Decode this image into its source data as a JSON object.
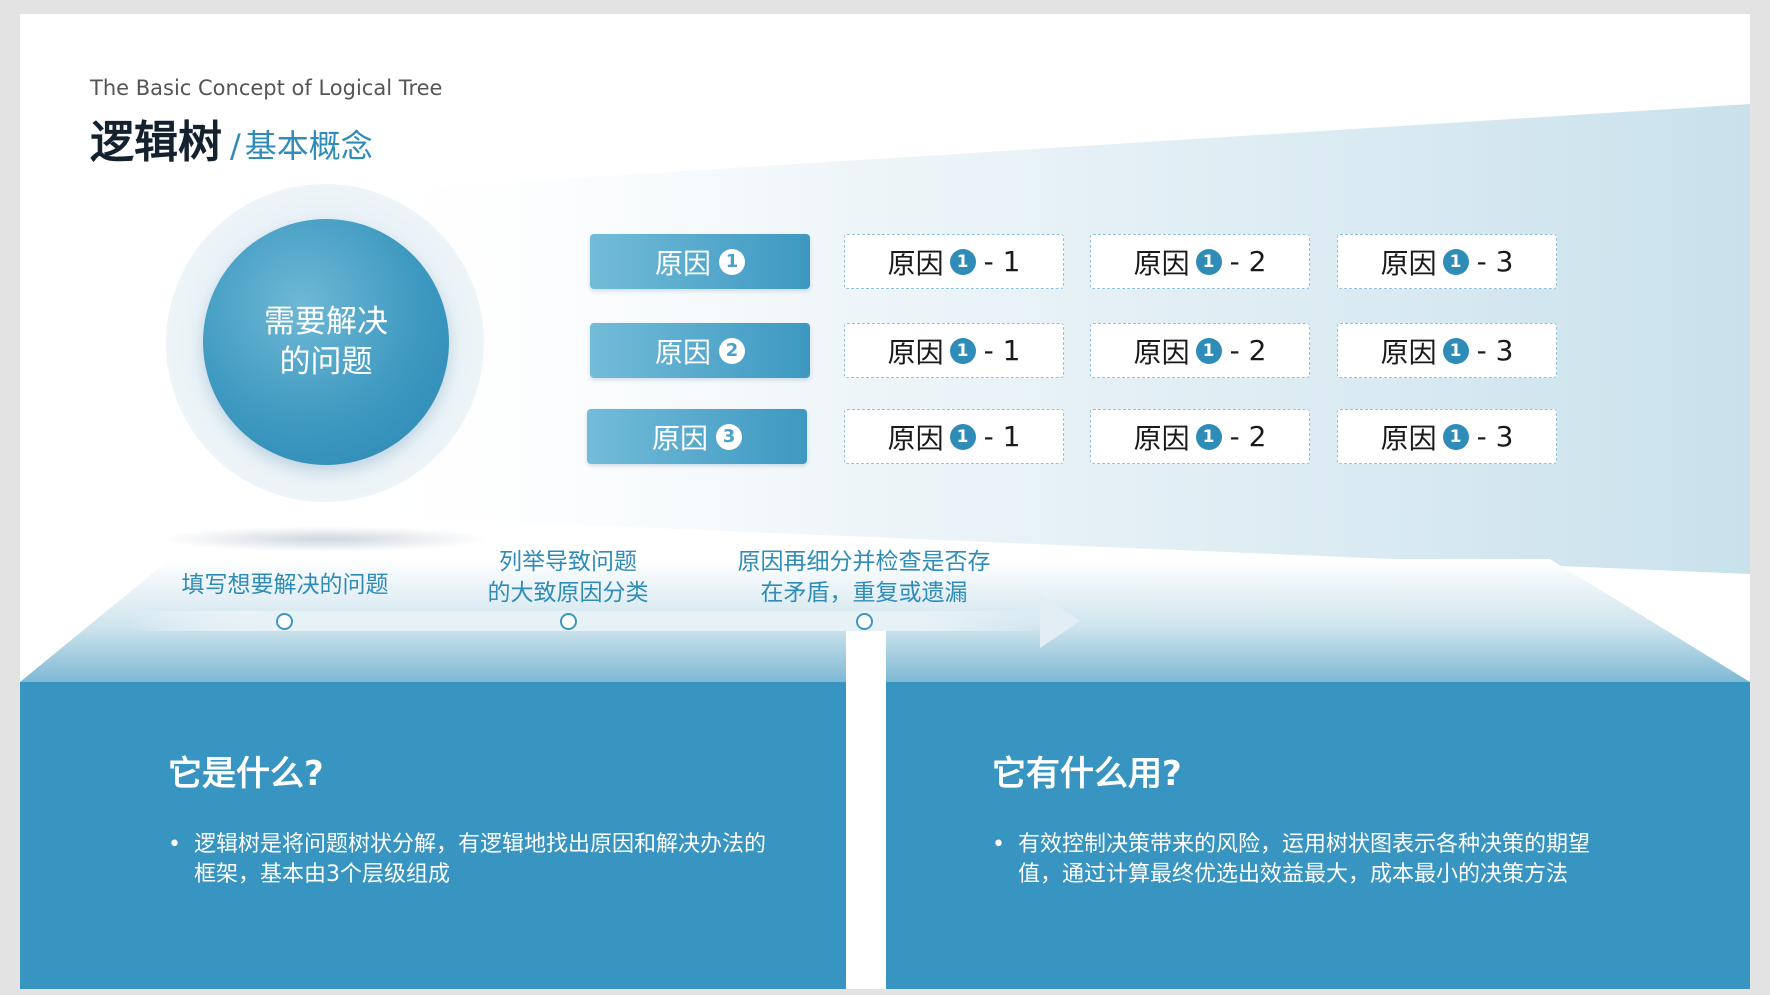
{
  "header": {
    "subtitle_en": "The Basic Concept of Logical Tree",
    "title": "逻辑树",
    "separator": "/",
    "title_sub": "基本概念"
  },
  "problem": {
    "text": "需要解决的问题"
  },
  "causes": [
    {
      "label": "原因",
      "num": "1"
    },
    {
      "label": "原因",
      "num": "2"
    },
    {
      "label": "原因",
      "num": "3"
    }
  ],
  "subcauses": {
    "row1": [
      {
        "label": "原因",
        "num": "1",
        "suffix": "- 1"
      },
      {
        "label": "原因",
        "num": "1",
        "suffix": "- 2"
      },
      {
        "label": "原因",
        "num": "1",
        "suffix": "- 3"
      }
    ],
    "row2": [
      {
        "label": "原因",
        "num": "1",
        "suffix": "- 1"
      },
      {
        "label": "原因",
        "num": "1",
        "suffix": "- 2"
      },
      {
        "label": "原因",
        "num": "1",
        "suffix": "- 3"
      }
    ],
    "row3": [
      {
        "label": "原因",
        "num": "1",
        "suffix": "- 1"
      },
      {
        "label": "原因",
        "num": "1",
        "suffix": "- 2"
      },
      {
        "label": "原因",
        "num": "1",
        "suffix": "- 3"
      }
    ]
  },
  "steps": [
    {
      "line1": "填写想要解决的问题",
      "line2": ""
    },
    {
      "line1": "列举导致问题",
      "line2": "的大致原因分类"
    },
    {
      "line1": "原因再细分并检查是否存",
      "line2": "在矛盾，重复或遗漏"
    }
  ],
  "panels": {
    "left": {
      "title": "它是什么?",
      "bullet": "•",
      "text": "逻辑树是将问题树状分解，有逻辑地找出原因和解决办法的框架，基本由3个层级组成"
    },
    "right": {
      "title": "它有什么用?",
      "bullet": "•",
      "text": "有效控制决策带来的风险，运用树状图表示各种决策的期望值，通过计算最终优选出效益最大，成本最小的决策方法"
    }
  },
  "colors": {
    "accent": "#2f8cb8",
    "panel": "#3894c0",
    "title": "#14222f"
  }
}
